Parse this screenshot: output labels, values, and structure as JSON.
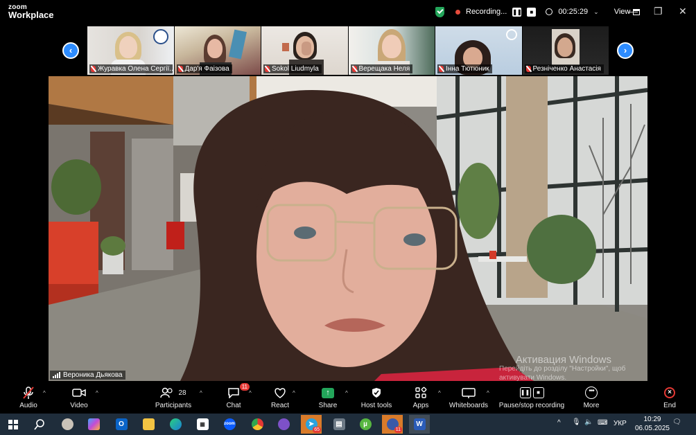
{
  "app": {
    "brand_line1": "zoom",
    "brand_line2": "Workplace"
  },
  "titlebar": {
    "recording_label": "Recording...",
    "timer": "00:25:29",
    "view_label": "View"
  },
  "gallery": {
    "participants": [
      {
        "name": "Журавка Олена Сергії...",
        "muted": true
      },
      {
        "name": "Дар'я Фаізова",
        "muted": true
      },
      {
        "name": "Sokol Liudmyla",
        "muted": true
      },
      {
        "name": "Верещака Неля",
        "muted": true
      },
      {
        "name": "Інна Тютюник",
        "muted": true
      },
      {
        "name": "Резніченко Анастасія",
        "muted": true
      }
    ]
  },
  "main": {
    "speaker_name": "Вероника Дьякова",
    "watermark_title": "Активация Windows",
    "watermark_line1": "Перейдіть до розділу \"Настройки\", щоб",
    "watermark_line2": "активувати Windows."
  },
  "toolbar": {
    "audio": "Audio",
    "video": "Video",
    "participants": "Participants",
    "participants_count": "28",
    "chat": "Chat",
    "chat_badge": "11",
    "react": "React",
    "share": "Share",
    "host_tools": "Host tools",
    "apps": "Apps",
    "whiteboards": "Whiteboards",
    "pause_stop": "Pause/stop recording",
    "more": "More",
    "end": "End"
  },
  "taskbar": {
    "telegram_badge": "65",
    "ball_badge": "11",
    "language": "УКР",
    "time": "10:29",
    "date": "06.05.2025"
  },
  "colors": {
    "accent": "#2d8cff",
    "danger": "#e53935",
    "share_green": "#23a55a"
  }
}
